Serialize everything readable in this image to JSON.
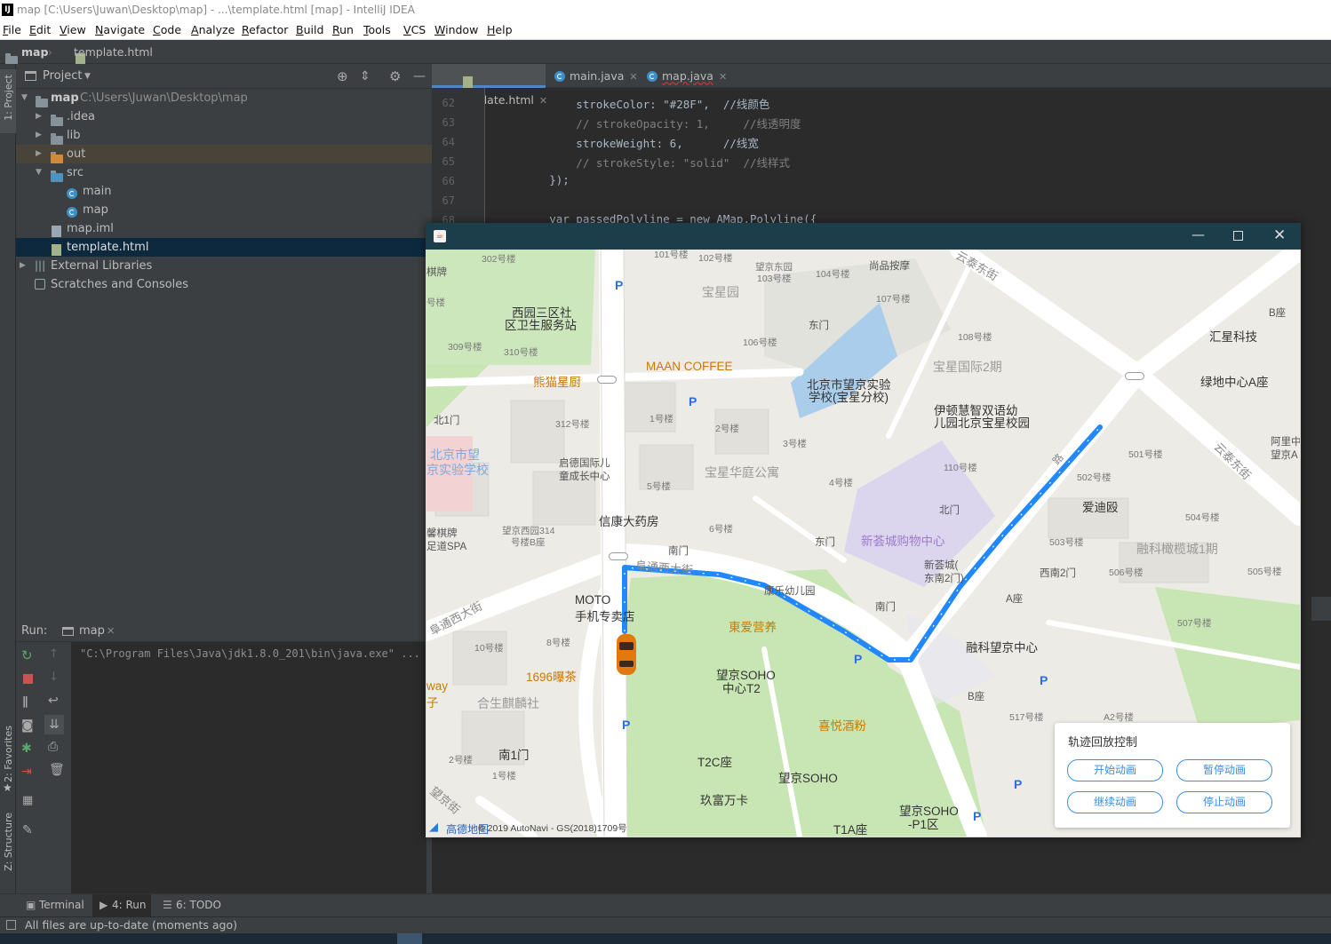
{
  "window": {
    "title": "map [C:\\Users\\Juwan\\Desktop\\map] - ...\\template.html [map] - IntelliJ IDEA"
  },
  "menu": [
    "File",
    "Edit",
    "View",
    "Navigate",
    "Code",
    "Analyze",
    "Refactor",
    "Build",
    "Run",
    "Tools",
    "VCS",
    "Window",
    "Help"
  ],
  "breadcrumb": {
    "project": "map",
    "file": "template.html"
  },
  "left_tool": {
    "project": "1: Project",
    "favorites": "2: Favorites",
    "structure": "Z: Structure"
  },
  "project_panel": {
    "title": "Project",
    "root_name": "map",
    "root_path": "C:\\Users\\Juwan\\Desktop\\map",
    "items": [
      ".idea",
      "lib",
      "out",
      "src",
      "main",
      "map",
      "map.iml",
      "template.html",
      "External Libraries",
      "Scratches and Consoles"
    ]
  },
  "editor": {
    "tabs": [
      "template.html",
      "main.java",
      "map.java"
    ],
    "line_numbers": [
      "62",
      "63",
      "64",
      "65",
      "66",
      "67",
      "68"
    ],
    "lines": [
      "            strokeColor: \"#28F\",  //线颜色",
      "            // strokeOpacity: 1,     //线透明度",
      "            strokeWeight: 6,      //线宽",
      "            // strokeStyle: \"solid\"  //线样式",
      "        });",
      "",
      "        var passedPolyline = new AMap.Polyline({"
    ]
  },
  "run_panel": {
    "label": "Run:",
    "tab": "map",
    "console_line": "\"C:\\Program Files\\Java\\jdk1.8.0_201\\bin\\java.exe\" ..."
  },
  "bottom_tabs": [
    "Terminal",
    "4: Run",
    "6: TODO"
  ],
  "status": "All files are up-to-date (moments ago)",
  "map": {
    "labels": {
      "l302": "302号楼",
      "l101": "101号楼",
      "l102": "102号楼",
      "wjdy": "望京东园",
      "l103": "103号楼",
      "l104": "104号楼",
      "sptm": "尚品按摩",
      "ytdj": "云泰东街",
      "qp": "棋牌",
      "hao": "号楼",
      "wy3": "西园三区社",
      "wy3b": "区卫生服务站",
      "bxy": "宝星园",
      "l107": "107号楼",
      "bz": "B座",
      "hxkj": "汇星科技",
      "l309": "309号楼",
      "l310": "310号楼",
      "l106": "106号楼",
      "dm1": "东门",
      "l108": "108号楼",
      "bxgj": "宝星国际2期",
      "maan": "MAAN COFFEE",
      "xmxc": "熊猫星厨",
      "bjwj": "北京市望京实验",
      "bjwjb": "学校(宝星分校)",
      "ydzs": "伊顿慧智双语幼",
      "ydzsb": "儿园北京宝星校园",
      "lzzx": "绿地中心A座",
      "bm": "北1门",
      "l312": "312号楼",
      "l1": "1号楼",
      "l2": "2号楼",
      "l3": "3号楼",
      "bjsw": "北京市望",
      "bjswb": "京实验学校",
      "aliy": "阿里中",
      "aliyb": "望京A",
      "qd": "启德国际儿",
      "qdb": "童成长中心",
      "bxhy": "宝星华庭公寓",
      "l110": "110号楼",
      "l501": "501号楼",
      "l502": "502号楼",
      "ltmp": "路",
      "l5": "5号楼",
      "l4": "4号楼",
      "adg": "爱迪殴",
      "ytdj2": "云泰东街",
      "xkdf": "信康大药房",
      "bm2": "北门",
      "l504": "504号楼",
      "xnqp": "馨棋牌",
      "xdspa": "足道SPA",
      "wjxy": "望京西园314",
      "wjxyb": "号楼B座",
      "l6": "6号楼",
      "dm2": "东门",
      "xhc": "新荟城购物中心",
      "l503": "503号楼",
      "rkgl": "融科橄榄城1期",
      "nm": "南门",
      "xhcn": "新荟城(",
      "xhcnb": "东南2门)",
      "xn2": "西南2门",
      "l506": "506号楼",
      "l505": "505号楼",
      "ftxdj": "阜通西大街",
      "ksl": "康乐幼儿园",
      "moto": "MOTO",
      "motob": "手机专卖店",
      "nm2": "南门",
      "az": "A座",
      "l507": "507号楼",
      "ftxdj2": "阜通西大街",
      "l10": "10号楼",
      "l8": "8号楼",
      "jazy": "東爱营养",
      "wjsoho": "望京SOHO",
      "wjsohob": "中心T2",
      "rkwj": "融科望京中心",
      "ch1696": "1696曝茶",
      "way": "way",
      "zi": "子",
      "hsqls": "合生麒麟社",
      "bz2": "B座",
      "l517": "517号楼",
      "xyfs": "喜悦酒粉",
      "a2": "A2号楼",
      "nm1": "南1门",
      "l2b": "2号楼",
      "t2c": "T2C座",
      "wjsoho2": "望京SOHO",
      "l1b": "1号楼",
      "wjj": "望京街",
      "jfwk": "玖富万卡",
      "wjsohop": "望京SOHO",
      "wjsohopb": "-P1区",
      "t1a": "T1A座",
      "logo": "高德地图",
      "copy": "© 2019 AutoNavi - GS(2018)1709号"
    },
    "control": {
      "title": "轨迹回放控制",
      "start": "开始动画",
      "pause": "暂停动画",
      "resume": "继续动画",
      "stop": "停止动画"
    },
    "route": {
      "color": "#28F"
    }
  }
}
